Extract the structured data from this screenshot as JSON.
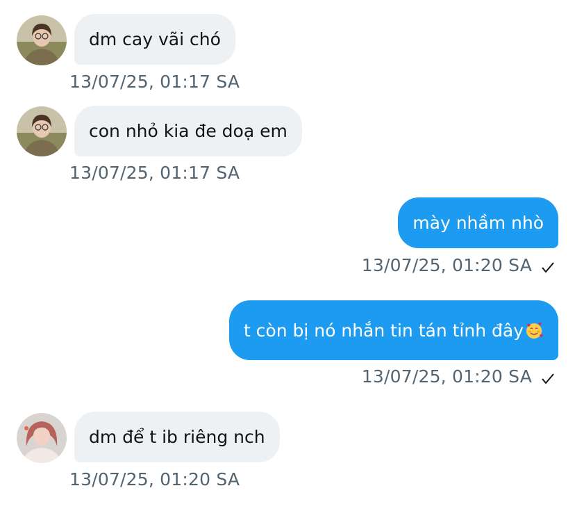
{
  "messages": [
    {
      "text": "dm cay vãi chó",
      "time": "13/07/25, 01:17 SA"
    },
    {
      "text": "con nhỏ kia đe doạ em",
      "time": "13/07/25, 01:17 SA"
    },
    {
      "text": "mày nhầm nhò",
      "time": "13/07/25, 01:20 SA"
    },
    {
      "text": "t còn bị nó nhắn tin tán tỉnh đây",
      "emoji": "smiling-face-with-hearts",
      "time": "13/07/25, 01:20 SA"
    },
    {
      "text": "dm để t ib riêng nch",
      "time": "13/07/25, 01:20 SA"
    }
  ],
  "icons": {
    "read_receipt": "check-icon",
    "emoji": "smiling-face-with-hearts-icon"
  },
  "colors": {
    "outgoing_bubble": "#1d9bf0",
    "incoming_bubble": "#eef1f4",
    "timestamp": "#536471"
  }
}
